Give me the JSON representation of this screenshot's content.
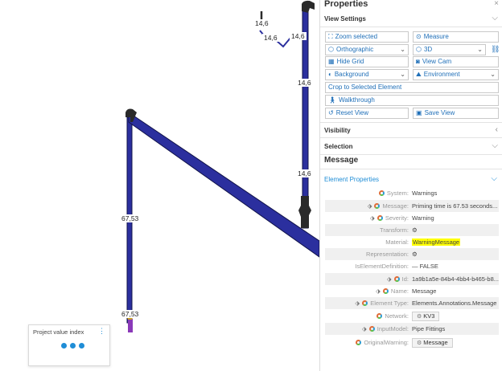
{
  "viewport": {
    "dimension_labels": [
      "14,6",
      "14,6",
      "14,6",
      "14,6",
      "14,6",
      "67,53",
      "67,53"
    ]
  },
  "project_value_index": {
    "title": "Project value index",
    "menu_icon": "vertical-dots-icon"
  },
  "properties": {
    "title": "Properties",
    "close_glyph": "×",
    "view_settings": {
      "label": "View Settings",
      "buttons": {
        "zoom_selected": "Zoom selected",
        "measure": "Measure",
        "orthographic": "Orthographic",
        "mode_3d": "3D",
        "hide_grid": "Hide Grid",
        "view_cam": "View Cam",
        "background": "Background",
        "environment": "Environment",
        "crop": "Crop to Selected Element",
        "walkthrough": "Walkthrough",
        "reset_view": "Reset View",
        "save_view": "Save View"
      }
    },
    "visibility_label": "Visibility",
    "selection_label": "Selection",
    "message_title": "Message",
    "element_properties_label": "Element Properties",
    "rows": {
      "system": {
        "key": "System:",
        "value": "Warnings"
      },
      "message": {
        "key": "Message:",
        "value": "Priming time is 67.53 seconds..."
      },
      "severity": {
        "key": "Severity:",
        "value": "Warning"
      },
      "transform": {
        "key": "Transform:",
        "value": "⚙"
      },
      "material": {
        "key": "Material:",
        "value": "WarningMessage"
      },
      "representation": {
        "key": "Representation:",
        "value": "⚙"
      },
      "is_element_definition": {
        "key": "IsElementDefinition:",
        "value": "— FALSE"
      },
      "id": {
        "key": "Id:",
        "value": "1a9b1a5e-84b4-4bb4-b465-b8..."
      },
      "name": {
        "key": "Name:",
        "value": "Message"
      },
      "element_type": {
        "key": "Element Type:",
        "value": "Elements.Annotations.Message"
      },
      "network": {
        "key": "Network:",
        "value": "KV3"
      },
      "input_model": {
        "key": "InputModel:",
        "value": "Pipe Fittings"
      },
      "original_warning": {
        "key": "OriginalWarning:",
        "value": "Message"
      }
    }
  },
  "colors": {
    "pipe": "#2b2f9e",
    "pipe_outline": "#11134a",
    "fitting": "#2a2a2a",
    "valve_purple": "#8a39b8",
    "accent": "#1f8dd6",
    "highlight": "#ffff00"
  }
}
